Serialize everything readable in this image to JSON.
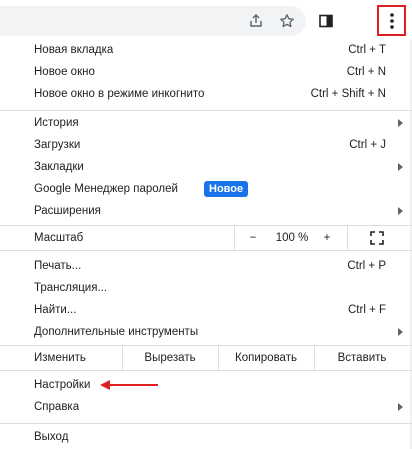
{
  "menu_items_group1": [
    {
      "label": "Новая вкладка",
      "shortcut": "Ctrl + T"
    },
    {
      "label": "Новое окно",
      "shortcut": "Ctrl + N"
    },
    {
      "label": "Новое окно в режиме инкогнито",
      "shortcut": "Ctrl + Shift + N"
    }
  ],
  "menu_items_group2": [
    {
      "label": "История",
      "shortcut": ""
    },
    {
      "label": "Загрузки",
      "shortcut": "Ctrl + J"
    },
    {
      "label": "Закладки",
      "shortcut": ""
    },
    {
      "label": "Google Менеджер паролей",
      "shortcut": ""
    },
    {
      "label": "Расширения",
      "shortcut": ""
    }
  ],
  "password_badge": "Новое",
  "zoom": {
    "label": "Масштаб",
    "minus": "−",
    "value": "100 %",
    "plus": "+"
  },
  "menu_items_group3": [
    {
      "label": "Печать...",
      "shortcut": "Ctrl + P"
    },
    {
      "label": "Трансляция...",
      "shortcut": ""
    },
    {
      "label": "Найти...",
      "shortcut": "Ctrl + F"
    },
    {
      "label": "Дополнительные инструменты",
      "shortcut": ""
    }
  ],
  "edit": {
    "label": "Изменить",
    "cut": "Вырезать",
    "copy": "Копировать",
    "paste": "Вставить"
  },
  "menu_items_group4": [
    {
      "label": "Настройки"
    },
    {
      "label": "Справка"
    }
  ],
  "exit_label": "Выход",
  "colors": {
    "badge": "#1a73e8",
    "highlight": "#e02020",
    "separator": "#dadce0"
  }
}
